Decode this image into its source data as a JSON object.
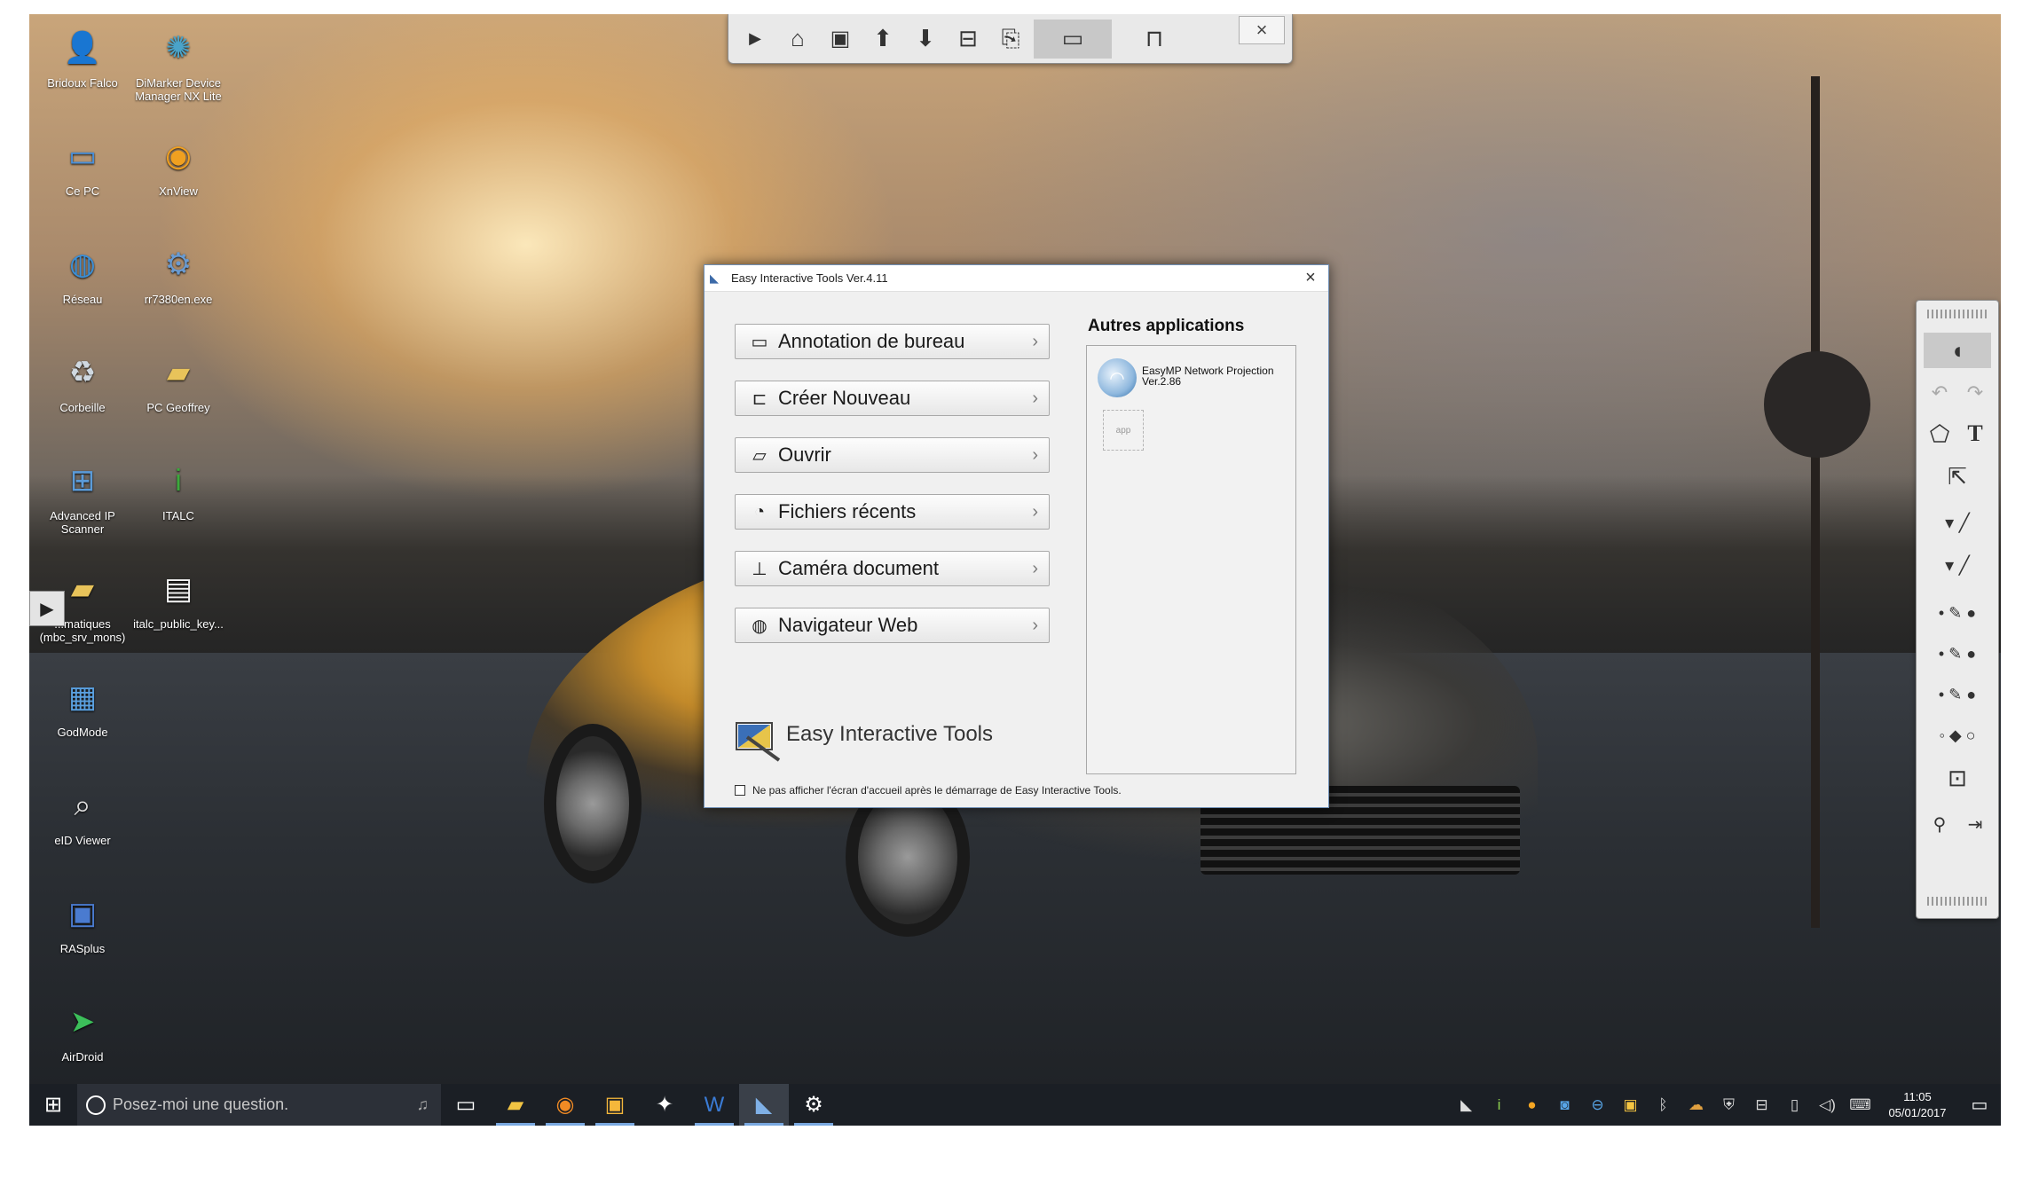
{
  "desktop": {
    "icons": [
      {
        "label": "Bridoux Falco",
        "icon": "user-folder-icon"
      },
      {
        "label": "DiMarker Device Manager NX Lite",
        "icon": "network-globe-icon"
      },
      {
        "label": "Ce PC",
        "icon": "computer-icon"
      },
      {
        "label": "XnView",
        "icon": "eye-viewer-icon"
      },
      {
        "label": "Réseau",
        "icon": "network-icon"
      },
      {
        "label": "rr7380en.exe",
        "icon": "installer-icon"
      },
      {
        "label": "Corbeille",
        "icon": "recycle-bin-icon"
      },
      {
        "label": "PC Geoffrey",
        "icon": "folder-icon"
      },
      {
        "label": "Advanced IP Scanner",
        "icon": "ip-scanner-icon"
      },
      {
        "label": "ITALC",
        "icon": "info-icon"
      },
      {
        "label": "...matiques (mbc_srv_mons)",
        "icon": "folder-icon"
      },
      {
        "label": "italc_public_key...",
        "icon": "document-icon"
      },
      {
        "label": "GodMode",
        "icon": "control-panel-icon"
      },
      {
        "label": "eID Viewer",
        "icon": "eid-viewer-icon"
      },
      {
        "label": "RASplus",
        "icon": "rasplus-icon"
      },
      {
        "label": "AirDroid",
        "icon": "airdroid-icon"
      }
    ]
  },
  "top_toolbar": {
    "buttons": [
      "play-icon",
      "home-icon",
      "save-icon",
      "arrow-up-icon",
      "arrow-down-icon",
      "toolbox-icon",
      "import-icon",
      "desktop-mode-icon",
      "whiteboard-mode-icon"
    ],
    "close_label": "×"
  },
  "dialog": {
    "title": "Easy Interactive Tools Ver.4.11",
    "close_label": "×",
    "menu": [
      {
        "label": "Annotation de bureau",
        "icon": "monitor-icon"
      },
      {
        "label": "Créer Nouveau",
        "icon": "new-board-icon"
      },
      {
        "label": "Ouvrir",
        "icon": "open-folder-icon"
      },
      {
        "label": "Fichiers récents",
        "icon": "clock-icon"
      },
      {
        "label": "Caméra document",
        "icon": "document-camera-icon"
      },
      {
        "label": "Navigateur Web",
        "icon": "globe-icon"
      }
    ],
    "apps_title": "Autres applications",
    "apps": [
      {
        "name": "EasyMP Network Projection",
        "version": "Ver.2.86"
      },
      {
        "name": "app"
      }
    ],
    "brand": "Easy Interactive Tools",
    "startup_checkbox": {
      "label": "Ne pas afficher l'écran d'accueil après le démarrage de Easy Interactive Tools.",
      "checked": false
    }
  },
  "palette": {
    "tools": [
      "mouse-icon",
      "undo-icon",
      "redo-icon",
      "shapes-icon",
      "text-icon",
      "select-arrow-icon",
      "pen-icon",
      "highlighter-icon",
      "pen-thin-icon",
      "pen-medium-icon",
      "pen-thick-icon",
      "eraser-icon",
      "screen-capture-icon",
      "settings-icon",
      "exit-icon"
    ],
    "text_tool_label": "T"
  },
  "taskbar": {
    "search_placeholder": "Posez-moi une question.",
    "apps": [
      "task-view-icon",
      "file-explorer-icon",
      "firefox-icon",
      "outlook-icon",
      "paint-icon",
      "word-icon",
      "easy-interactive-tools-icon",
      "settings-icon"
    ],
    "clock": {
      "time": "11:05",
      "date": "05/01/2017"
    }
  }
}
